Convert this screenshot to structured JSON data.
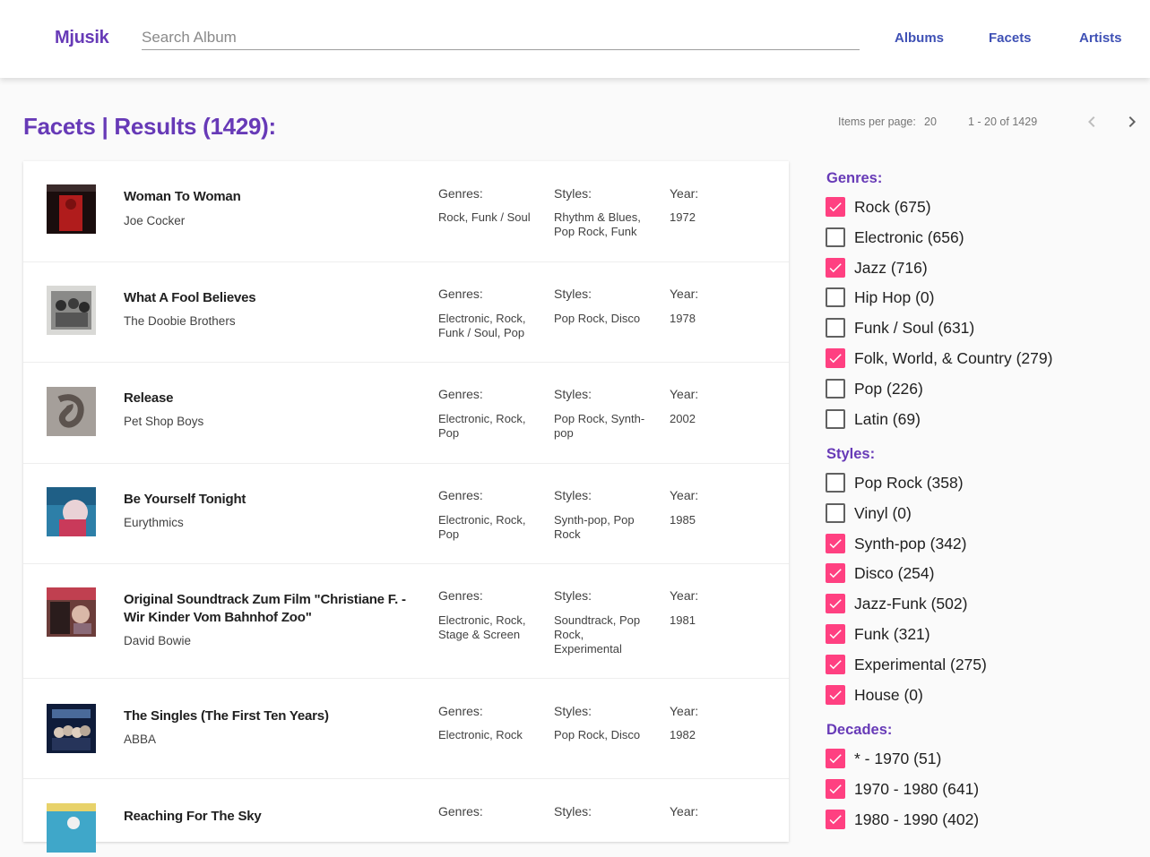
{
  "app": {
    "brand": "Mjusik"
  },
  "search": {
    "placeholder": "Search Album",
    "value": ""
  },
  "nav": [
    "Albums",
    "Facets",
    "Artists"
  ],
  "heading": "Facets | Results (1429):",
  "paginator": {
    "items_per_page_label": "Items per page:",
    "items_per_page": "20",
    "range": "1 - 20 of 1429"
  },
  "column_labels": {
    "genres": "Genres:",
    "styles": "Styles:",
    "year": "Year:"
  },
  "albums": [
    {
      "title": "Woman To Woman",
      "artist": "Joe Cocker",
      "genres": "Rock, Funk / Soul",
      "styles": "Rhythm & Blues, Pop Rock, Funk",
      "year": "1972",
      "cover_colors": [
        "#1a0d0d",
        "#b01c1c"
      ]
    },
    {
      "title": "What A Fool Believes",
      "artist": "The Doobie Brothers",
      "genres": "Electronic, Rock, Funk / Soul, Pop",
      "styles": "Pop Rock, Disco",
      "year": "1978",
      "cover_colors": [
        "#d9d9d6",
        "#555555"
      ]
    },
    {
      "title": "Release",
      "artist": "Pet Shop Boys",
      "genres": "Electronic, Rock, Pop",
      "styles": "Pop Rock, Synth-pop",
      "year": "2002",
      "cover_colors": [
        "#a59f9a",
        "#5c534e"
      ]
    },
    {
      "title": "Be Yourself Tonight",
      "artist": "Eurythmics",
      "genres": "Electronic, Rock, Pop",
      "styles": "Synth-pop, Pop Rock",
      "year": "1985",
      "cover_colors": [
        "#2d7fa8",
        "#c93a5a"
      ]
    },
    {
      "title": "Original Soundtrack Zum Film \"Christiane F. - Wir Kinder Vom Bahnhof Zoo\"",
      "artist": "David Bowie",
      "genres": "Electronic, Rock, Stage & Screen",
      "styles": "Soundtrack, Pop Rock, Experimental",
      "year": "1981",
      "cover_colors": [
        "#6b3d3a",
        "#c04050"
      ]
    },
    {
      "title": "The Singles (The First Ten Years)",
      "artist": "ABBA",
      "genres": "Electronic, Rock",
      "styles": "Pop Rock, Disco",
      "year": "1982",
      "cover_colors": [
        "#0f1c3a",
        "#4a6a9a"
      ]
    },
    {
      "title": "Reaching For The Sky",
      "artist": "",
      "genres": "",
      "styles": "",
      "year": "",
      "cover_colors": [
        "#3fa7c9",
        "#e8d26a"
      ]
    }
  ],
  "facets": {
    "genres": {
      "title": "Genres:",
      "items": [
        {
          "label": "Rock (675)",
          "checked": true
        },
        {
          "label": "Electronic (656)",
          "checked": false
        },
        {
          "label": "Jazz (716)",
          "checked": true
        },
        {
          "label": "Hip Hop (0)",
          "checked": false
        },
        {
          "label": "Funk / Soul (631)",
          "checked": false
        },
        {
          "label": "Folk, World, & Country (279)",
          "checked": true
        },
        {
          "label": "Pop (226)",
          "checked": false
        },
        {
          "label": "Latin (69)",
          "checked": false
        }
      ]
    },
    "styles": {
      "title": "Styles:",
      "items": [
        {
          "label": "Pop Rock (358)",
          "checked": false
        },
        {
          "label": "Vinyl (0)",
          "checked": false
        },
        {
          "label": "Synth-pop (342)",
          "checked": true
        },
        {
          "label": "Disco (254)",
          "checked": true
        },
        {
          "label": "Jazz-Funk (502)",
          "checked": true
        },
        {
          "label": "Funk (321)",
          "checked": true
        },
        {
          "label": "Experimental (275)",
          "checked": true
        },
        {
          "label": "House (0)",
          "checked": true
        }
      ]
    },
    "decades": {
      "title": "Decades:",
      "items": [
        {
          "label": "* - 1970 (51)",
          "checked": true
        },
        {
          "label": "1970 - 1980 (641)",
          "checked": true
        },
        {
          "label": "1980 - 1990 (402)",
          "checked": true
        }
      ]
    }
  },
  "colors": {
    "brand": "#673ab7",
    "nav_link": "#3f51b5",
    "checkbox_checked": "#ff4081"
  }
}
